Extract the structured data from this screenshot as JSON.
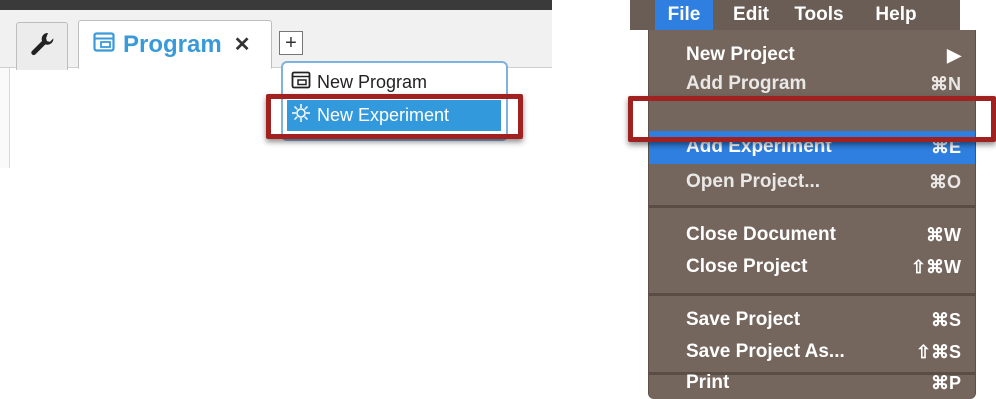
{
  "left_app": {
    "tools_tab_icon": "wrench-icon",
    "program_tab": {
      "icon": "program-icon",
      "label": "Program",
      "close_glyph": "✕"
    },
    "add_tab_glyph": "+",
    "new_menu": {
      "items": [
        {
          "icon": "program-icon",
          "label": "New Program"
        },
        {
          "icon": "experiment-icon",
          "label": "New Experiment",
          "highlighted": true
        }
      ]
    },
    "colors": {
      "tab_accent": "#3a9ad9",
      "highlight": "#3399dd",
      "callout": "#a12020"
    }
  },
  "mac_menu": {
    "menubar": [
      "File",
      "Edit",
      "Tools",
      "Help"
    ],
    "active_menu": "File",
    "items": [
      {
        "label": "New Project",
        "shortcut": "▶"
      },
      {
        "label": "Add Program",
        "shortcut": "⌘N"
      },
      {
        "label": "Add Experiment",
        "shortcut": "⌘E",
        "selected": true
      },
      {
        "label": "Open Project...",
        "shortcut": "⌘O"
      },
      {
        "label": "Close Document",
        "shortcut": "⌘W"
      },
      {
        "label": "Close Project",
        "shortcut": "⇧⌘W"
      },
      {
        "label": "Save Project",
        "shortcut": "⌘S"
      },
      {
        "label": "Save Project As...",
        "shortcut": "⇧⌘S"
      },
      {
        "label": "Print",
        "shortcut": "⌘P"
      }
    ],
    "colors": {
      "menu_bg": "#74665d",
      "selected": "#2f7fe0",
      "callout": "#a12020"
    }
  }
}
